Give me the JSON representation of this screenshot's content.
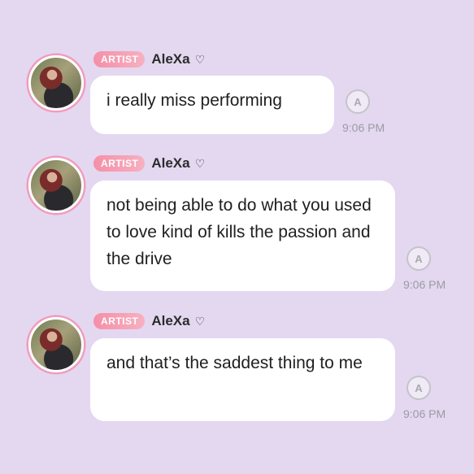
{
  "messages": [
    {
      "badge": "ARTIST",
      "username": "AleXa",
      "heart": "♡",
      "text": "i really miss performing",
      "time": "9:06 PM",
      "translate_glyph": "A"
    },
    {
      "badge": "ARTIST",
      "username": "AleXa",
      "heart": "♡",
      "text": "not being able to do what you used to love kind of kills the passion and the drive",
      "time": "9:06 PM",
      "translate_glyph": "A"
    },
    {
      "badge": "ARTIST",
      "username": "AleXa",
      "heart": "♡",
      "text": "and that’s the saddest thing to me",
      "time": "9:06 PM",
      "translate_glyph": "A"
    }
  ],
  "colors": {
    "background": "#e3d8f0",
    "badge": "#f58fa8",
    "avatar_ring": "#f29bbd",
    "bubble": "#ffffff",
    "timestamp": "#9c9aa3"
  },
  "icons": {
    "translate": "translate-icon",
    "avatar": "avatar-image"
  }
}
